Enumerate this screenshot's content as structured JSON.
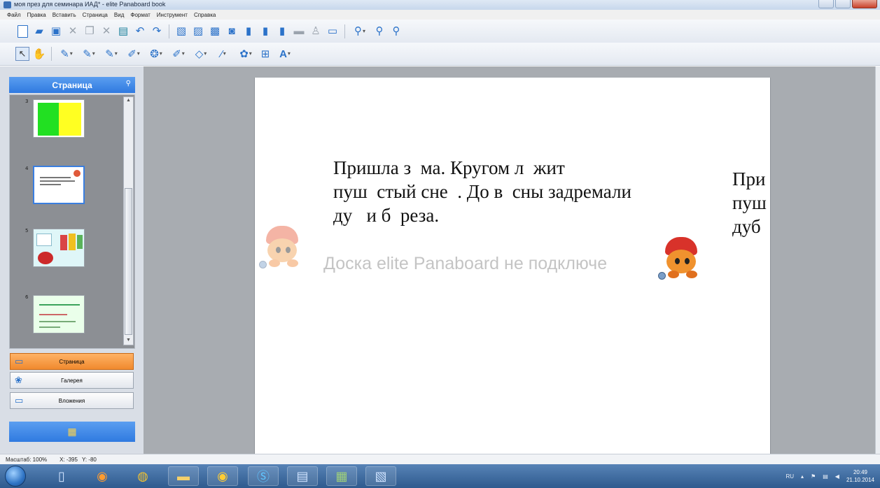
{
  "window": {
    "title": "моя през для семинара ИАД* - elite Panaboard book"
  },
  "menu": [
    "Файл",
    "Правка",
    "Вставить",
    "Страница",
    "Вид",
    "Формат",
    "Инструмент",
    "Справка"
  ],
  "toolbar1": {
    "icons": [
      "new-page-icon",
      "open-folder-icon",
      "save-icon",
      "cut-icon",
      "copy-icon",
      "delete-icon",
      "paste-icon",
      "undo-icon",
      "redo-icon",
      "insert-page-icon",
      "insert-image-icon",
      "insert-file-icon",
      "capture-icon",
      "camera-icon",
      "screen-capture-icon",
      "print-icon",
      "lock-icon",
      "export-icon",
      "fullscreen-icon",
      "zoom-icon",
      "zoom-in-icon",
      "zoom-out-icon"
    ]
  },
  "toolbar2": {
    "icons": [
      "select-cursor-icon",
      "hand-icon",
      "pen-icon",
      "marker-icon",
      "highlighter-icon",
      "brush-icon",
      "fill-icon",
      "eraser-icon",
      "shape-icon",
      "line-icon",
      "stamp-icon",
      "screen-shade-icon",
      "text-icon"
    ]
  },
  "left_panel": {
    "header": "Страница",
    "thumbnails": [
      {
        "number": "3"
      },
      {
        "number": "4"
      },
      {
        "number": "5"
      },
      {
        "number": "6"
      }
    ],
    "tabs": [
      {
        "label": "Страница",
        "icon": "page-icon",
        "active": true
      },
      {
        "label": "Галерея",
        "icon": "gallery-icon",
        "active": false
      },
      {
        "label": "Вложения",
        "icon": "attachment-icon",
        "active": false
      }
    ]
  },
  "slide": {
    "text_main": "Пришла з  ма. Кругом л  жит\nпуш  стый сне  . До в  сны задремали\nду   и б  реза.",
    "text_overflow": "При\nпуш\nдуб",
    "watermark": "Доска elite Panaboard не подключе"
  },
  "statusbar": {
    "zoom": "Масштаб: 100%",
    "x": "X: -395",
    "y": "Y: -80"
  },
  "taskbar": {
    "apps": [
      "explorer-icon",
      "media-player-icon",
      "chrome-icon",
      "folder-icon",
      "player-icon",
      "skype-icon",
      "word-icon",
      "panaboard-icon",
      "presentation-icon"
    ],
    "language": "RU",
    "time": "20:49",
    "date": "21.10.2014"
  }
}
